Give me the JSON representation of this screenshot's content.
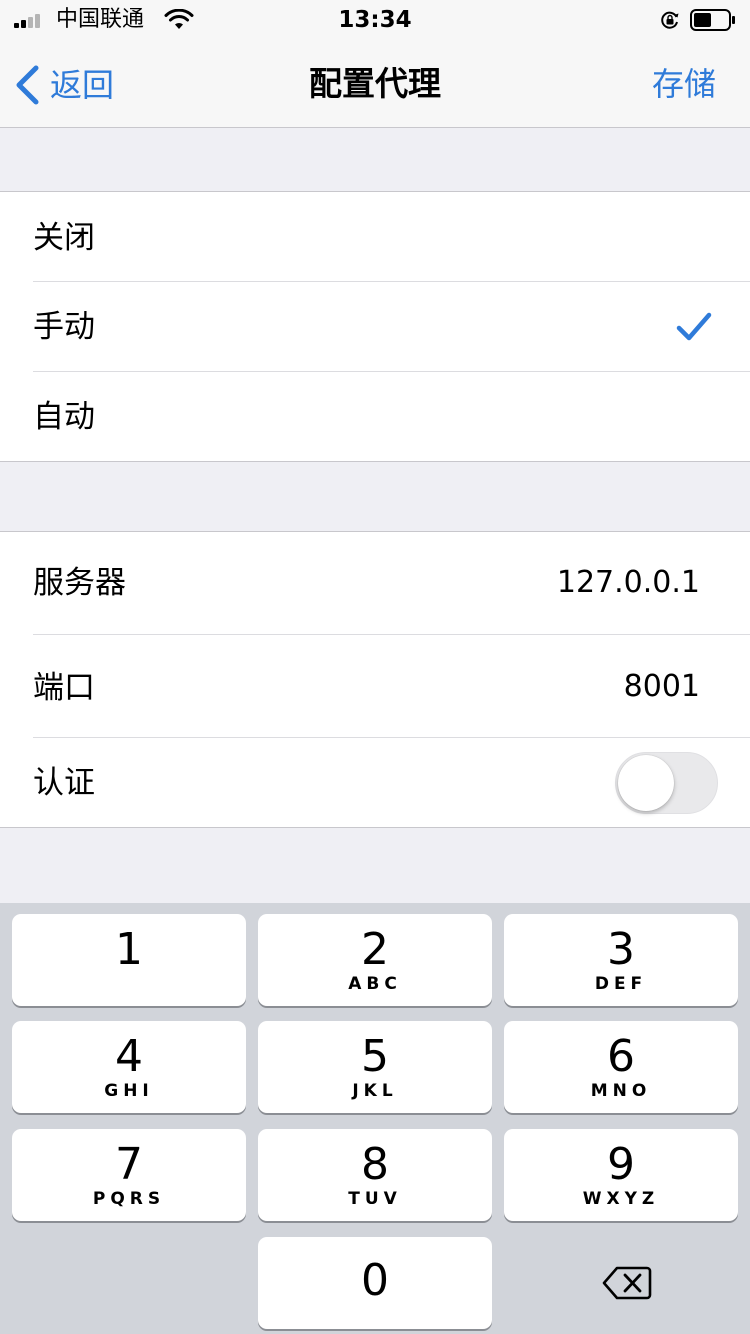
{
  "status_bar": {
    "carrier": "中国联通",
    "time": "13:34",
    "icons": [
      "signal-icon",
      "wifi-icon",
      "orientation-lock-icon",
      "battery-icon"
    ]
  },
  "nav": {
    "back_label": "返回",
    "title": "配置代理",
    "save_label": "存储",
    "accent_color": "#2f7bd9"
  },
  "proxy_modes": {
    "options": [
      {
        "label": "关闭",
        "selected": false
      },
      {
        "label": "手动",
        "selected": true
      },
      {
        "label": "自动",
        "selected": false
      }
    ]
  },
  "proxy_settings": {
    "server_label": "服务器",
    "server_value": "127.0.0.1",
    "port_label": "端口",
    "port_value": "8001",
    "auth_label": "认证",
    "auth_enabled": false
  },
  "keyboard": {
    "keys": [
      {
        "digit": "1",
        "letters": ""
      },
      {
        "digit": "2",
        "letters": "ABC"
      },
      {
        "digit": "3",
        "letters": "DEF"
      },
      {
        "digit": "4",
        "letters": "GHI"
      },
      {
        "digit": "5",
        "letters": "JKL"
      },
      {
        "digit": "6",
        "letters": "MNO"
      },
      {
        "digit": "7",
        "letters": "PQRS"
      },
      {
        "digit": "8",
        "letters": "TUV"
      },
      {
        "digit": "9",
        "letters": "WXYZ"
      },
      {
        "digit": "0",
        "letters": ""
      }
    ],
    "delete_icon": "backspace-icon"
  }
}
